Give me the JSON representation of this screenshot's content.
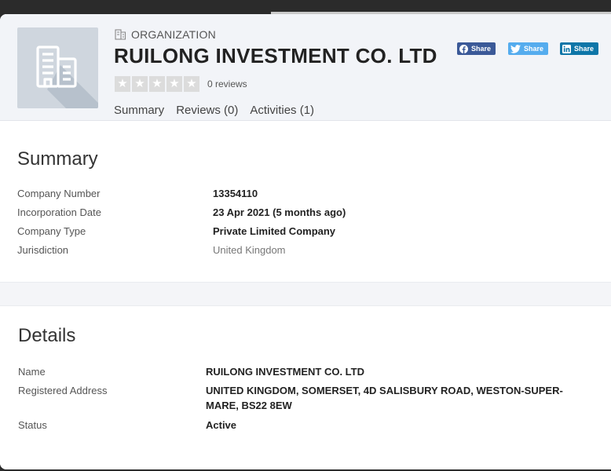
{
  "header": {
    "category_label": "ORGANIZATION",
    "title": "RUILONG INVESTMENT CO. LTD",
    "rating": {
      "stars": 5,
      "filled": 0
    },
    "reviews_text": "0 reviews",
    "tabs": [
      {
        "label": "Summary"
      },
      {
        "label": "Reviews (0)"
      },
      {
        "label": "Activities (1)"
      }
    ],
    "share_buttons": [
      {
        "network": "facebook",
        "label": "Share",
        "color": "#3b5998"
      },
      {
        "network": "twitter",
        "label": "Share",
        "color": "#55acee"
      },
      {
        "network": "linkedin",
        "label": "Share",
        "color": "#0e76a8"
      }
    ]
  },
  "summary": {
    "title": "Summary",
    "rows": [
      {
        "label": "Company Number",
        "value": "13354110"
      },
      {
        "label": "Incorporation Date",
        "value": "23 Apr 2021 (5 months ago)"
      },
      {
        "label": "Company Type",
        "value": "Private Limited Company"
      },
      {
        "label": "Jurisdiction",
        "value": "United Kingdom"
      }
    ]
  },
  "details": {
    "title": "Details",
    "rows": [
      {
        "label": "Name",
        "value": "RUILONG INVESTMENT CO. LTD"
      },
      {
        "label": "Registered Address",
        "value_line1": "UNITED KINGDOM, SOMERSET, 4D SALISBURY ROAD, WESTON-SUPER-",
        "value_line2": "MARE, BS22 8EW"
      },
      {
        "label": "Status",
        "value": "Active"
      }
    ]
  },
  "icons": {
    "logo": "building-icon",
    "category": "building-small-icon",
    "star": "star-icon"
  },
  "colors": {
    "header_bg": "#f2f4f8",
    "logo_bg": "#cfd6de",
    "star_empty": "#dcdcdc"
  }
}
